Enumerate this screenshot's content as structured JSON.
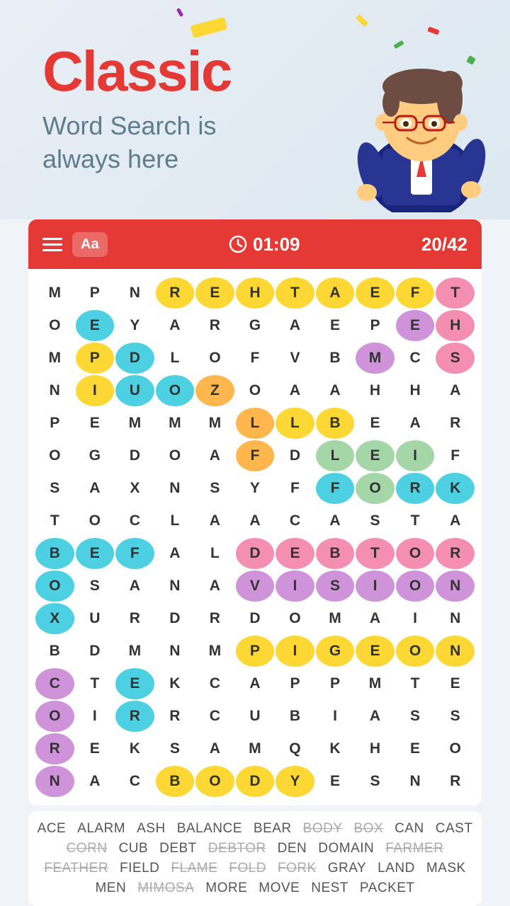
{
  "header": {
    "title": "Classic",
    "subtitle_line1": "Word Search is",
    "subtitle_line2": "always here"
  },
  "toolbar": {
    "menu_label": "menu",
    "font_label": "Aa",
    "timer": "01:09",
    "score": "20/42"
  },
  "grid": {
    "rows": [
      [
        "M",
        "P",
        "N",
        "R",
        "E",
        "H",
        "T",
        "A",
        "E",
        "F",
        "T"
      ],
      [
        "O",
        "E",
        "Y",
        "A",
        "R",
        "G",
        "A",
        "E",
        "P",
        "E",
        "H"
      ],
      [
        "M",
        "P",
        "D",
        "L",
        "O",
        "F",
        "V",
        "B",
        "M",
        "C",
        "S"
      ],
      [
        "N",
        "I",
        "U",
        "O",
        "Z",
        "O",
        "A",
        "A",
        "H",
        "H",
        "A"
      ],
      [
        "P",
        "E",
        "M",
        "M",
        "M",
        "L",
        "L",
        "B",
        "E",
        "A",
        "R"
      ],
      [
        "O",
        "G",
        "D",
        "O",
        "A",
        "F",
        "D",
        "L",
        "E",
        "I",
        "F"
      ],
      [
        "S",
        "A",
        "X",
        "N",
        "S",
        "Y",
        "F",
        "F",
        "O",
        "R",
        "K"
      ],
      [
        "T",
        "O",
        "C",
        "L",
        "A",
        "A",
        "C",
        "A",
        "S",
        "T",
        "A"
      ],
      [
        "B",
        "E",
        "F",
        "A",
        "L",
        "D",
        "E",
        "B",
        "T",
        "O",
        "R"
      ],
      [
        "O",
        "S",
        "A",
        "N",
        "A",
        "V",
        "I",
        "S",
        "I",
        "O",
        "N"
      ],
      [
        "X",
        "U",
        "R",
        "D",
        "R",
        "D",
        "O",
        "M",
        "A",
        "I",
        "N"
      ],
      [
        "B",
        "D",
        "M",
        "N",
        "M",
        "P",
        "I",
        "G",
        "E",
        "O",
        "N"
      ],
      [
        "C",
        "T",
        "E",
        "K",
        "C",
        "A",
        "P",
        "P",
        "M",
        "T",
        "E"
      ],
      [
        "O",
        "I",
        "R",
        "R",
        "C",
        "U",
        "B",
        "I",
        "A",
        "S",
        "S"
      ],
      [
        "R",
        "E",
        "K",
        "S",
        "A",
        "M",
        "Q",
        "K",
        "H",
        "E",
        "O"
      ],
      [
        "N",
        "A",
        "C",
        "B",
        "O",
        "D",
        "Y",
        "E",
        "S",
        "N",
        "R"
      ]
    ],
    "highlights": {
      "REHTAEF": {
        "color": "yellow",
        "row": 0,
        "cols": [
          3,
          9
        ]
      },
      "FEATHER": {
        "note": "row0 R-E-H-T-A-E-F reversed"
      },
      "FORK": {
        "color": "cyan",
        "row": 6,
        "cols": [
          7,
          10
        ]
      },
      "DEBTOR": {
        "color": "pink",
        "row": 8,
        "cols": [
          5,
          10
        ]
      },
      "VISION": {
        "color": "purple",
        "row": 9,
        "cols": [
          5,
          10
        ]
      },
      "PIGEON": {
        "color": "yellow",
        "row": 11,
        "cols": [
          5,
          10
        ]
      },
      "BODY": {
        "color": "yellow",
        "row": 15,
        "cols": [
          3,
          6
        ]
      },
      "BOX": {
        "color": "cyan",
        "rows": [
          8,
          10
        ],
        "col": 0
      },
      "CORN": {
        "color": "purple",
        "rows": [
          12,
          15
        ],
        "col": 0
      },
      "BEF": {
        "color": "cyan",
        "row": 8,
        "cols": [
          0,
          2
        ]
      },
      "EPEH": {
        "color": "purple",
        "diagonal": true
      }
    }
  },
  "words": [
    {
      "text": "ACE",
      "found": false
    },
    {
      "text": "ALARM",
      "found": false
    },
    {
      "text": "ASH",
      "found": false
    },
    {
      "text": "BALANCE",
      "found": false
    },
    {
      "text": "BEAR",
      "found": false
    },
    {
      "text": "BODY",
      "found": true
    },
    {
      "text": "BOX",
      "found": true
    },
    {
      "text": "CAN",
      "found": false
    },
    {
      "text": "CAST",
      "found": false
    },
    {
      "text": "CORN",
      "found": true
    },
    {
      "text": "CUB",
      "found": false
    },
    {
      "text": "DEBT",
      "found": false
    },
    {
      "text": "DEBTOR",
      "found": true
    },
    {
      "text": "DEN",
      "found": false
    },
    {
      "text": "DOMAIN",
      "found": false
    },
    {
      "text": "FARMER",
      "found": true
    },
    {
      "text": "FEATHER",
      "found": true
    },
    {
      "text": "FIELD",
      "found": false
    },
    {
      "text": "FLAME",
      "found": true
    },
    {
      "text": "FOLD",
      "found": true
    },
    {
      "text": "FORK",
      "found": true
    },
    {
      "text": "GRAY",
      "found": false
    },
    {
      "text": "LAND",
      "found": false
    },
    {
      "text": "MASK",
      "found": false
    },
    {
      "text": "MEN",
      "found": false
    },
    {
      "text": "MIMOSA",
      "found": true
    },
    {
      "text": "MORE",
      "found": false
    },
    {
      "text": "MOVE",
      "found": false
    },
    {
      "text": "NEST",
      "found": false
    },
    {
      "text": "PACKET",
      "found": false
    }
  ]
}
